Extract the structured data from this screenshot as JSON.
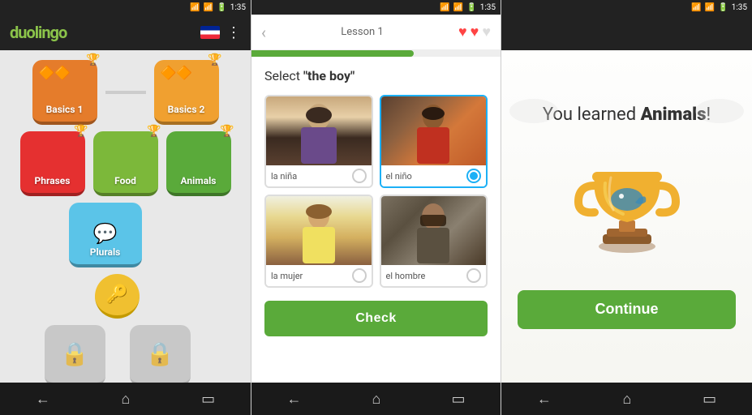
{
  "panel1": {
    "logo": "duolingo",
    "logo_dot": "o",
    "status_time": "1:35",
    "skills": [
      {
        "id": "basics1",
        "label": "Basics 1",
        "color": "basics1",
        "trophy": true,
        "crown": true
      },
      {
        "id": "basics2",
        "label": "Basics 2",
        "color": "basics2",
        "trophy": true,
        "crown": true
      },
      {
        "id": "phrases",
        "label": "Phrases",
        "color": "phrases",
        "trophy": true
      },
      {
        "id": "food",
        "label": "Food",
        "color": "food",
        "trophy": true
      },
      {
        "id": "animals",
        "label": "Animals",
        "color": "animals",
        "trophy": true
      },
      {
        "id": "plurals",
        "label": "Plurals",
        "color": "plurals"
      }
    ],
    "nav": [
      "←",
      "⌂",
      "▭"
    ]
  },
  "panel2": {
    "status_time": "1:35",
    "lesson_title": "Lesson 1",
    "hearts": [
      true,
      true,
      false
    ],
    "progress_pct": 65,
    "prompt_prefix": "Select ",
    "prompt_quoted": "\"the boy\"",
    "choices": [
      {
        "label": "la niña",
        "selected": false,
        "photo_class": "person-1"
      },
      {
        "label": "el niño",
        "selected": true,
        "photo_class": "person-2"
      },
      {
        "label": "la mujer",
        "selected": false,
        "photo_class": "person-3"
      },
      {
        "label": "el hombre",
        "selected": false,
        "photo_class": "person-4"
      }
    ],
    "check_label": "Check",
    "nav": [
      "←",
      "⌂",
      "▭"
    ]
  },
  "panel3": {
    "status_time": "1:35",
    "victory_prefix": "You learned ",
    "victory_subject": "Animals",
    "victory_suffix": "!",
    "continue_label": "Continue",
    "nav": [
      "←",
      "⌂",
      "▭"
    ]
  }
}
